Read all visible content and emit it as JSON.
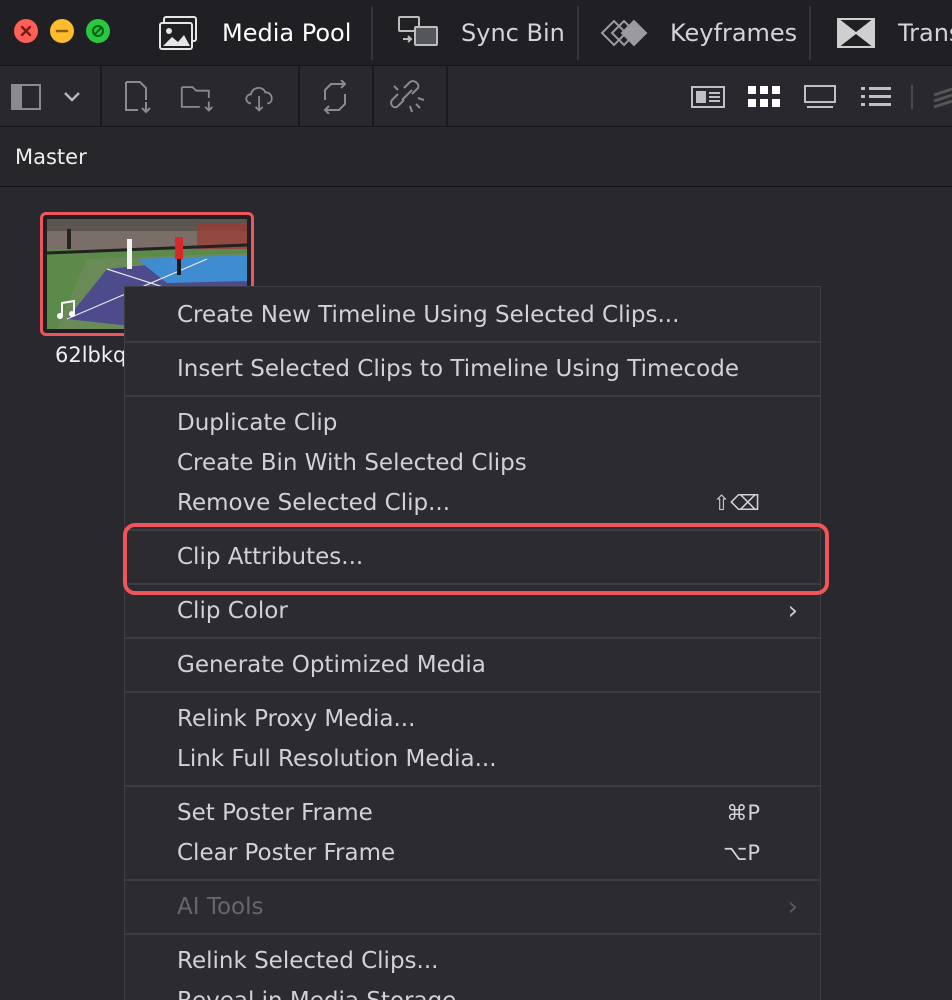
{
  "tabs": [
    {
      "label": "Media Pool",
      "icon": "media-pool-icon",
      "active": true
    },
    {
      "label": "Sync Bin",
      "icon": "sync-bin-icon"
    },
    {
      "label": "Keyframes",
      "icon": "keyframes-icon"
    },
    {
      "label": "Trans",
      "icon": "transitions-icon"
    }
  ],
  "breadcrumb": {
    "label": "Master"
  },
  "clip": {
    "name": "62lbkq",
    "badge_icon": "music-note-icon"
  },
  "menu": {
    "items": [
      {
        "label": "Create New Timeline Using Selected Clips..."
      },
      {
        "label": "Insert Selected Clips to Timeline Using Timecode"
      },
      {
        "label": "Duplicate Clip"
      },
      {
        "label": "Create Bin With Selected Clips"
      },
      {
        "label": "Remove Selected Clip...",
        "shortcut": "⇧⌫"
      },
      {
        "label": "Clip Attributes...",
        "highlighted": true
      },
      {
        "label": "Clip Color",
        "submenu": true
      },
      {
        "label": "Generate Optimized Media"
      },
      {
        "label": "Relink Proxy Media..."
      },
      {
        "label": "Link Full Resolution Media..."
      },
      {
        "label": "Set Poster Frame",
        "shortcut": "⌘P"
      },
      {
        "label": "Clear Poster Frame",
        "shortcut": "⌥P"
      },
      {
        "label": "AI Tools",
        "submenu": true,
        "disabled": true
      },
      {
        "label": "Relink Selected Clips..."
      },
      {
        "label": "Reveal in Media Storage"
      }
    ]
  },
  "colors": {
    "accent": "#f0555a",
    "menu_bg": "#2b2b30",
    "window_bg": "#28282e"
  }
}
